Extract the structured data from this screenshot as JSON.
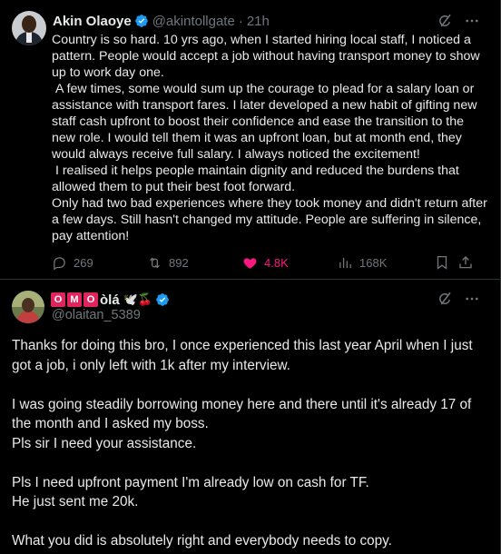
{
  "tweet1": {
    "author_name": "Akin Olaoye",
    "handle": "@akintollgate",
    "separator": "·",
    "time": "21h",
    "paragraphs": [
      "Country is so hard. 10 yrs ago, when I started hiring local staff, I noticed a pattern. People would accept a job without having transport money to show up to work day one.",
      " A few times, some would sum up the courage to plead for a salary loan or assistance with transport fares. I later developed a new habit of gifting new staff cash upfront to boost their confidence and ease the transition to the new role. I would tell them it was an upfront loan, but at month end, they would always receive full salary. I always noticed the excitement!",
      " I realised it helps people maintain dignity and reduced the burdens that allowed them to put their best foot forward.",
      "Only had two bad experiences where they took money and didn't return after a few days. Still hasn't changed my attitude. People are suffering in silence, pay attention!"
    ],
    "stats": {
      "replies": "269",
      "reposts": "892",
      "likes": "4.8K",
      "views": "168K"
    }
  },
  "tweet2": {
    "name_badges": [
      "O",
      "M",
      "O"
    ],
    "name_suffix": "òlá",
    "emojis": "🕊️🍒",
    "handle": "@olaitan_5389",
    "paragraphs": [
      "Thanks for doing this bro, I once experienced this last year April when I just got a job, i only left with 1k after my interview.",
      "",
      "I was going steadily borrowing money here and there until it's already 17 of the month and I asked my boss.",
      "Pls sir I need your assistance.",
      "",
      "Pls I need upfront payment I'm already low on cash for TF.",
      "He just sent me 20k.",
      "",
      "What you did is absolutely right and everybody needs to copy."
    ]
  },
  "icons": {
    "verified": "verified-badge-icon",
    "grok": "grok-icon",
    "more": "more-icon",
    "reply": "reply-icon",
    "repost": "repost-icon",
    "like": "heart-icon",
    "views": "views-icon",
    "bookmark": "bookmark-icon",
    "share": "share-icon"
  },
  "colors": {
    "background": "#000000",
    "text": "#e7e9ea",
    "muted": "#71767b",
    "verified": "#1d9bf0",
    "like": "#f91880",
    "badge": "#e0245e"
  }
}
